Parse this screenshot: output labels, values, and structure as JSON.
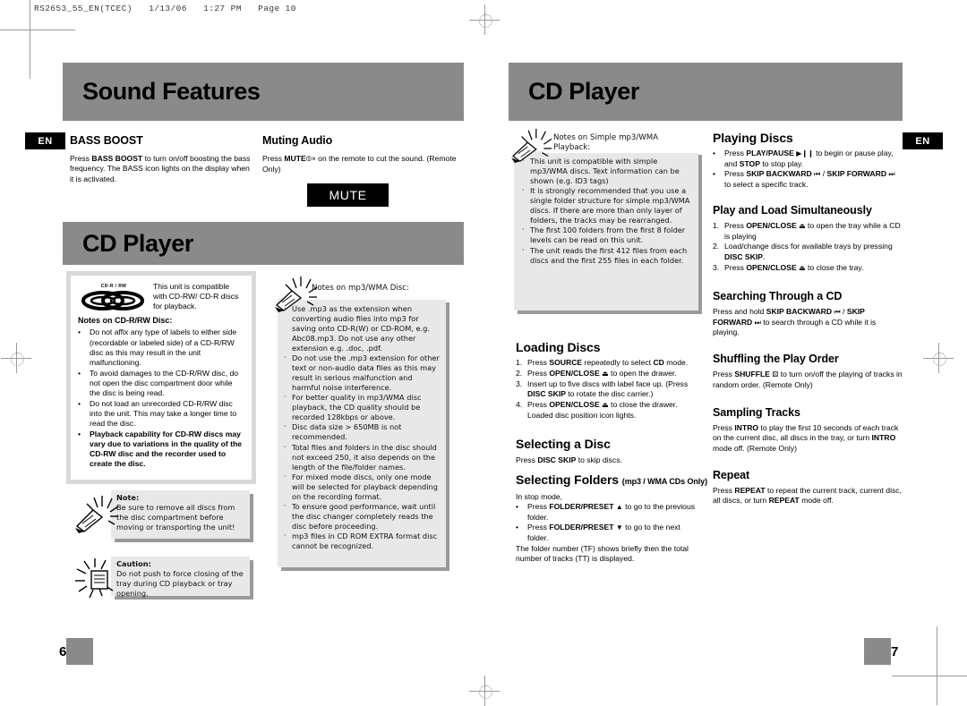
{
  "printer": {
    "file_header": "RS2653_55_EN(TCEC)   1/13/06   1:27 PM   Page 10"
  },
  "left_page": {
    "number": "6",
    "en_tag": "EN",
    "banner_sound": "Sound Features",
    "banner_cd": "CD Player",
    "bass_boost": {
      "heading": "BASS BOOST",
      "body_1": "Press ",
      "body_b1": "BASS BOOST",
      "body_2": " to turn on/off boosting the bass frequency. The BASS icon lights on the display when it is activated."
    },
    "muting": {
      "heading": "Muting Audio",
      "body_1": "Press ",
      "body_b1": "MUTE",
      "body_icon": "⦷×",
      "body_2": " on the remote to cut the sound. (Remote Only)",
      "keycap": "MUTE"
    },
    "cdrw_box": {
      "logo_caption": "CD-R / RW",
      "intro": "This unit is compatible with CD-RW/ CD-R discs for playback.",
      "heading": "Notes on CD-R/RW Disc:",
      "bullets": [
        "Do not affix any type of labels to either side (recordable or labeled side) of a CD-R/RW disc as this may result in the unit malfunctioning.",
        "To avoid damages to the CD-R/RW disc, do not open the disc compartment door while the disc is being read.",
        "Do not load an unrecorded CD-R/RW disc into the unit. This may take a longer time to read the disc."
      ],
      "bold_bullet": "Playback capability for CD-RW discs may vary due to variations in the quality of the CD-RW disc and the recorder used to create the disc."
    },
    "note_box": {
      "title": "Note:",
      "text": "Be sure to remove all discs from the disc compartment before moving or transporting the  unit!"
    },
    "caution_box": {
      "title": "Caution:",
      "text": "Do not push to force closing of the tray during CD playback or tray opening."
    },
    "mp3_box": {
      "title": "Notes on mp3/WMA Disc:",
      "bullets": [
        "Use .mp3 as the extension when converting audio files into mp3 for saving onto CD-R(W) or CD-ROM, e.g. Abc08.mp3. Do not use any other extension e.g. .doc, .pdf.",
        "Do not use the .mp3 extension for other text or non-audio data files as this may result in serious malfunction and harmful noise interference.",
        "For better quality in mp3/WMA disc playback, the CD quality should be recorded 128kbps or above.",
        "Disc data size > 650MB is not recommended.",
        "Total files and folders in the disc should not exceed 250, it also depends on the length of the file/folder names.",
        "For mixed mode discs, only one mode will be selected for playback depending on the recording format.",
        "To ensure good performance, wait until the disc changer completely reads the disc before proceeding.",
        "mp3 files in CD ROM EXTRA format disc cannot be recognized."
      ]
    }
  },
  "right_page": {
    "number": "7",
    "en_tag": "EN",
    "banner_cd": "CD Player",
    "simple_box": {
      "title": "Notes on Simple mp3/WMA Playback:",
      "bullets": [
        "This unit is compatible with simple mp3/WMA discs. Text information can be shown (e.g. ID3 tags)",
        "It is strongly recommended that you use a single folder structure for simple mp3/WMA discs. If there are more than only layer of folders, the tracks may be rearranged.",
        "The first 100 folders from the first 8 folder levels can be read on this unit.",
        "The unit reads the first 412 files from each discs and the first 255 files in each folder."
      ]
    },
    "loading_discs": {
      "heading": "Loading Discs",
      "steps": [
        {
          "n": "1.",
          "pre": "Press ",
          "b": "SOURCE",
          "post": " repeatedly to select ",
          "b2": "CD",
          "post2": " mode."
        },
        {
          "n": "2.",
          "pre": "Press ",
          "b": "OPEN/CLOSE",
          "icon": "⏏",
          "post": " to open the drawer."
        },
        {
          "n": "3.",
          "pre": "Insert up to five discs with label face up. (Press ",
          "b": "DISC SKIP",
          "post": " to rotate the disc carrier.)"
        },
        {
          "n": "4.",
          "pre": "Press ",
          "b": "OPEN/CLOSE",
          "icon": "⏏",
          "post": " to close the drawer. Loaded disc position icon lights."
        }
      ]
    },
    "selecting_disc": {
      "heading": "Selecting a Disc",
      "pre": "Press ",
      "b": "DISC SKIP",
      "post": " to skip discs."
    },
    "selecting_folders": {
      "heading": "Selecting Folders",
      "heading_sub": "(mp3 / WMA CDs Only)",
      "intro": "In stop mode,",
      "bullets": [
        {
          "pre": "Press ",
          "b": "FOLDER/PRESET",
          "icon": "▲",
          "post": " to go to the previous folder."
        },
        {
          "pre": "Press ",
          "b": "FOLDER/PRESET",
          "icon": "▼",
          "post": " to go to the next folder."
        }
      ],
      "outro": "The folder number (TF) shows briefly then the total number of tracks (TT) is displayed."
    },
    "playing_discs": {
      "heading": "Playing Discs",
      "bullets": [
        {
          "pre": "Press ",
          "b": "PLAY/PAUSE",
          "icon": "▶❙❙",
          "post": " to begin or pause  play, and ",
          "b2": "STOP",
          "post2": " to stop play."
        },
        {
          "pre": "Press ",
          "b": "SKIP BACKWARD",
          "icon": "⏮",
          "post": " / ",
          "b2": "SKIP FORWARD",
          "icon2": "⏭",
          "post2": " to select a specific track."
        }
      ]
    },
    "play_load": {
      "heading": "Play and Load Simultaneously",
      "steps": [
        {
          "n": "1.",
          "pre": "Press ",
          "b": "OPEN/CLOSE",
          "icon": "⏏",
          "post": " to open the tray while a CD is playing"
        },
        {
          "n": "2.",
          "pre": "Load/change discs for available trays by pressing ",
          "b": "DISC SKIP",
          "post": "."
        },
        {
          "n": "3.",
          "pre": "Press ",
          "b": "OPEN/CLOSE",
          "icon": "⏏",
          "post": " to close the tray."
        }
      ]
    },
    "searching": {
      "heading": "Searching Through a CD",
      "pre": "Press and hold ",
      "b": "SKIP BACKWARD",
      "icon": "⏮",
      "mid": " / ",
      "b2": "SKIP FORWARD",
      "icon2": "⏭",
      "post": " to search through a CD while it is playing."
    },
    "shuffling": {
      "heading": "Shuffling the Play Order",
      "pre": "Press ",
      "b": "SHUFFLE",
      "icon": "⚄",
      "post": " to turn on/off the playing of tracks in random order. (Remote Only)"
    },
    "sampling": {
      "heading": "Sampling Tracks",
      "pre": "Press ",
      "b": "INTRO",
      "post": " to play the first 10 seconds of each track on the current disc, all discs in the tray, or turn ",
      "b2": "INTRO",
      "post2": " mode off.  (Remote Only)"
    },
    "repeat": {
      "heading": "Repeat",
      "pre": "Press ",
      "b": "REPEAT",
      "post": " to repeat the current track, current disc, all discs, or turn ",
      "b2": "REPEAT",
      "post2": " mode off."
    }
  },
  "colors": {
    "banner_grey": "#8a8a8a",
    "box_grey": "#d9d9d9",
    "note_grey": "#e8e8e8",
    "black": "#000000"
  }
}
